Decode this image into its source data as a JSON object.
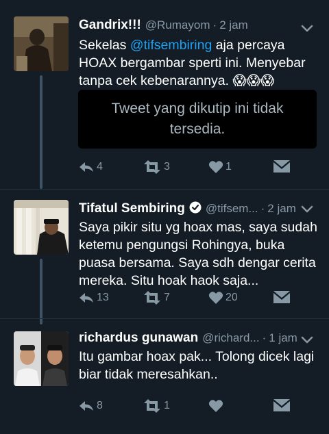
{
  "colors": {
    "background": "#141d26",
    "link": "#1da1f2",
    "muted": "#8899a6"
  },
  "tweets": [
    {
      "name": "Gandrix!!!",
      "handle": "@Rumayom",
      "separator": "·",
      "time": "2 jam",
      "text_pre": "Sekelas ",
      "mention": "@tifsembiring",
      "text_post": " aja percaya HOAX bergambar sperti ini. Menyebar tanpa cek kebenarannya. ",
      "emoji": "😱😱😱",
      "quote": "Tweet yang dikutip ini tidak tersedia.",
      "replies": "4",
      "retweets": "3",
      "likes": "1"
    },
    {
      "name": "Tifatul Sembiring",
      "verified": true,
      "handle": "@tifsem...",
      "separator": "·",
      "time": "2 jam",
      "text": "Saya pikir situ yg hoax mas, saya sudah ketemu pengungsi Rohingya, buka puasa bersama. Saya sdh dengar cerita mereka. Situ hoak haok saja...",
      "replies": "13",
      "retweets": "7",
      "likes": "20"
    },
    {
      "name": "richardus gunawan",
      "handle": "@richard...",
      "separator": "·",
      "time": "1 jam",
      "text": "Itu gambar hoax pak... Tolong dicek lagi biar tidak meresahkan..",
      "replies": "8",
      "retweets": "1",
      "likes": ""
    }
  ]
}
